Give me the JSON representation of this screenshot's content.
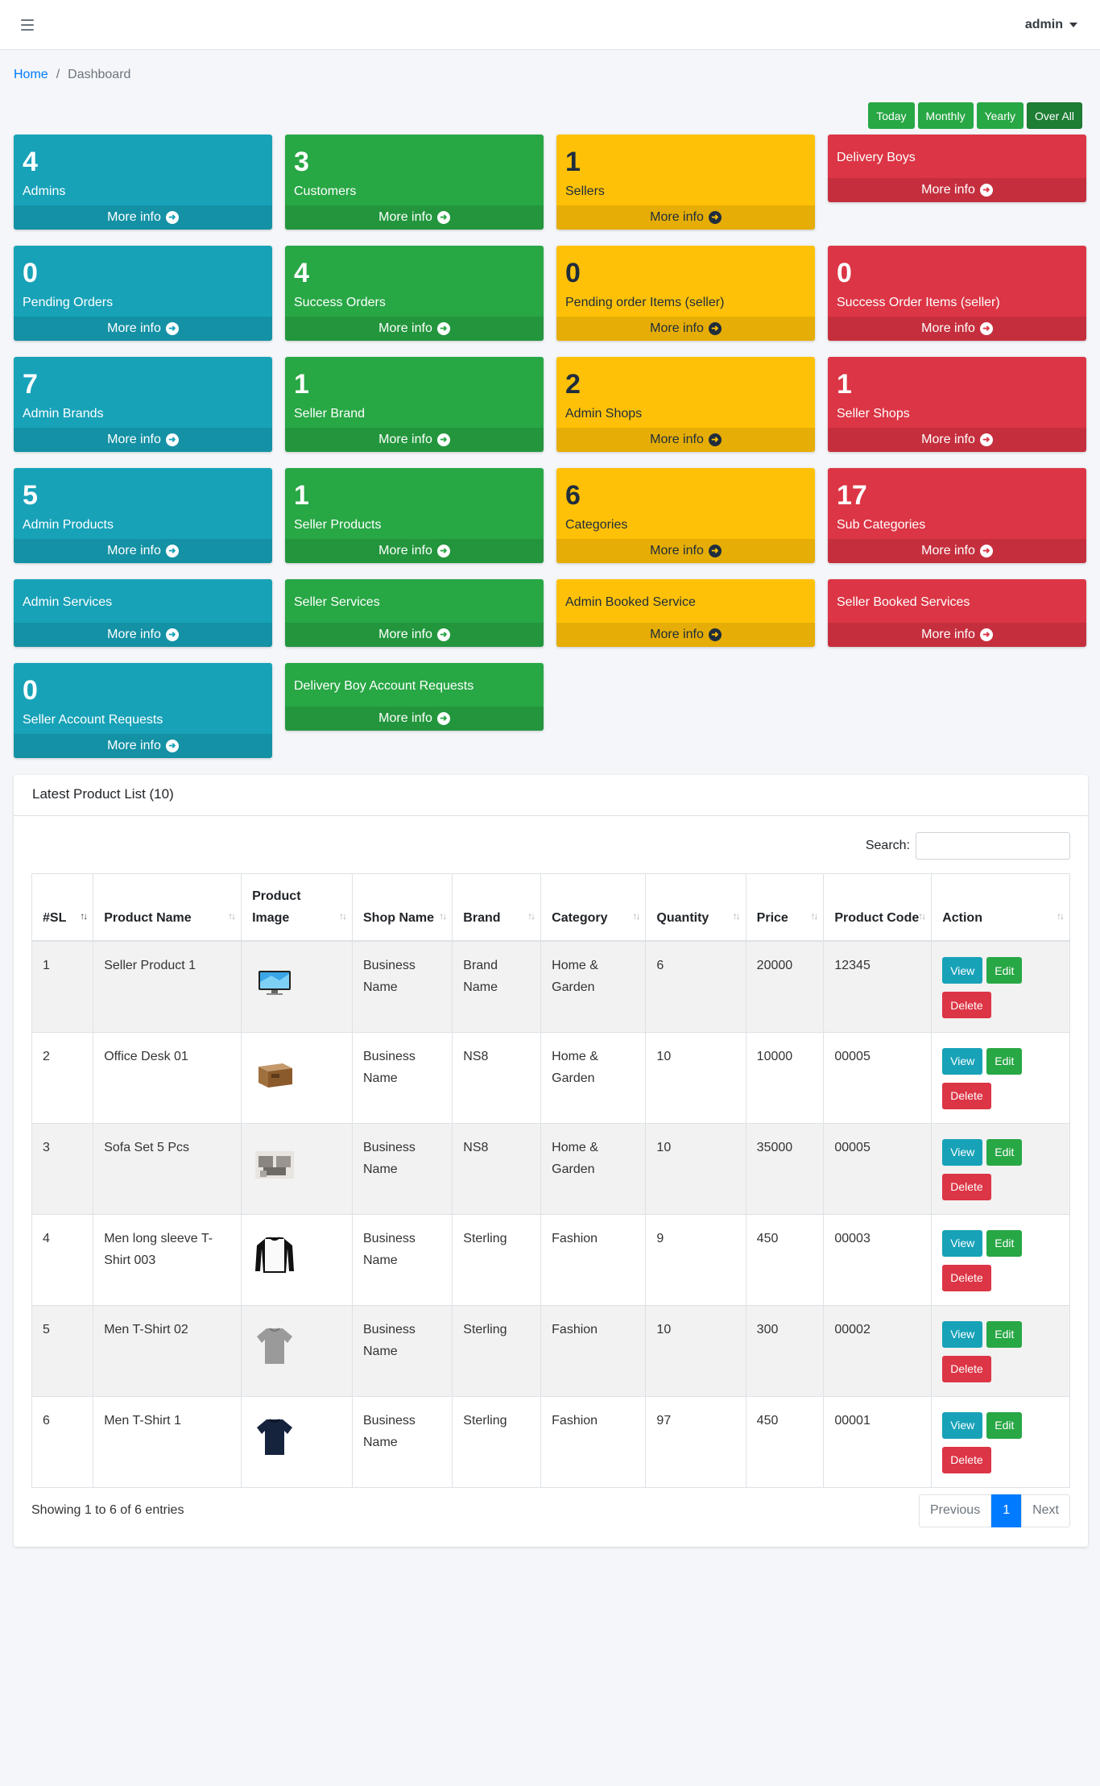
{
  "header": {
    "user": "admin"
  },
  "breadcrumb": {
    "home": "Home",
    "current": "Dashboard"
  },
  "filters": [
    "Today",
    "Monthly",
    "Yearly",
    "Over All"
  ],
  "more_info": "More info",
  "stats": [
    {
      "count": "4",
      "label": "Admins",
      "color": "info"
    },
    {
      "count": "3",
      "label": "Customers",
      "color": "success"
    },
    {
      "count": "1",
      "label": "Sellers",
      "color": "warning"
    },
    {
      "count": "",
      "label": "Delivery Boys",
      "color": "danger"
    },
    {
      "count": "0",
      "label": "Pending Orders",
      "color": "info"
    },
    {
      "count": "4",
      "label": "Success Orders",
      "color": "success"
    },
    {
      "count": "0",
      "label": "Pending order Items (seller)",
      "color": "warning"
    },
    {
      "count": "0",
      "label": "Success Order Items (seller)",
      "color": "danger"
    },
    {
      "count": "7",
      "label": "Admin Brands",
      "color": "info"
    },
    {
      "count": "1",
      "label": "Seller Brand",
      "color": "success"
    },
    {
      "count": "2",
      "label": "Admin Shops",
      "color": "warning"
    },
    {
      "count": "1",
      "label": "Seller Shops",
      "color": "danger"
    },
    {
      "count": "5",
      "label": "Admin Products",
      "color": "info"
    },
    {
      "count": "1",
      "label": "Seller Products",
      "color": "success"
    },
    {
      "count": "6",
      "label": "Categories",
      "color": "warning"
    },
    {
      "count": "17",
      "label": "Sub Categories",
      "color": "danger"
    },
    {
      "count": "",
      "label": "Admin Services",
      "color": "info"
    },
    {
      "count": "",
      "label": "Seller Services",
      "color": "success"
    },
    {
      "count": "",
      "label": "Admin Booked Service",
      "color": "warning"
    },
    {
      "count": "",
      "label": "Seller Booked Services",
      "color": "danger"
    },
    {
      "count": "0",
      "label": "Seller Account Requests",
      "color": "info"
    },
    {
      "count": "",
      "label": "Delivery Boy Account Requests",
      "color": "success"
    }
  ],
  "product_card": {
    "title": "Latest Product List (10)",
    "search_label": "Search:",
    "search_value": "",
    "columns": [
      "#SL",
      "Product Name",
      "Product Image",
      "Shop Name",
      "Brand",
      "Category",
      "Quantity",
      "Price",
      "Product Code",
      "Action"
    ],
    "rows": [
      {
        "sl": "1",
        "name": "Seller Product 1",
        "image": "monitor",
        "shop": "Business Name",
        "brand": "Brand Name",
        "category": "Home & Garden",
        "quantity": "6",
        "price": "20000",
        "code": "12345"
      },
      {
        "sl": "2",
        "name": "Office Desk 01",
        "image": "desk",
        "shop": "Business Name",
        "brand": "NS8",
        "category": "Home & Garden",
        "quantity": "10",
        "price": "10000",
        "code": "00005"
      },
      {
        "sl": "3",
        "name": "Sofa Set 5 Pcs",
        "image": "sofa",
        "shop": "Business Name",
        "brand": "NS8",
        "category": "Home & Garden",
        "quantity": "10",
        "price": "35000",
        "code": "00005"
      },
      {
        "sl": "4",
        "name": "Men long sleeve T-Shirt 003",
        "image": "longsleeve",
        "shop": "Business Name",
        "brand": "Sterling",
        "category": "Fashion",
        "quantity": "9",
        "price": "450",
        "code": "00003"
      },
      {
        "sl": "5",
        "name": "Men T-Shirt 02",
        "image": "tshirt-grey",
        "shop": "Business Name",
        "brand": "Sterling",
        "category": "Fashion",
        "quantity": "10",
        "price": "300",
        "code": "00002"
      },
      {
        "sl": "6",
        "name": "Men T-Shirt 1",
        "image": "tshirt-navy",
        "shop": "Business Name",
        "brand": "Sterling",
        "category": "Fashion",
        "quantity": "97",
        "price": "450",
        "code": "00001"
      }
    ],
    "actions": {
      "view": "View",
      "edit": "Edit",
      "delete": "Delete"
    },
    "showing": "Showing 1 to 6 of 6 entries",
    "pagination": {
      "previous": "Previous",
      "current": "1",
      "next": "Next"
    }
  }
}
